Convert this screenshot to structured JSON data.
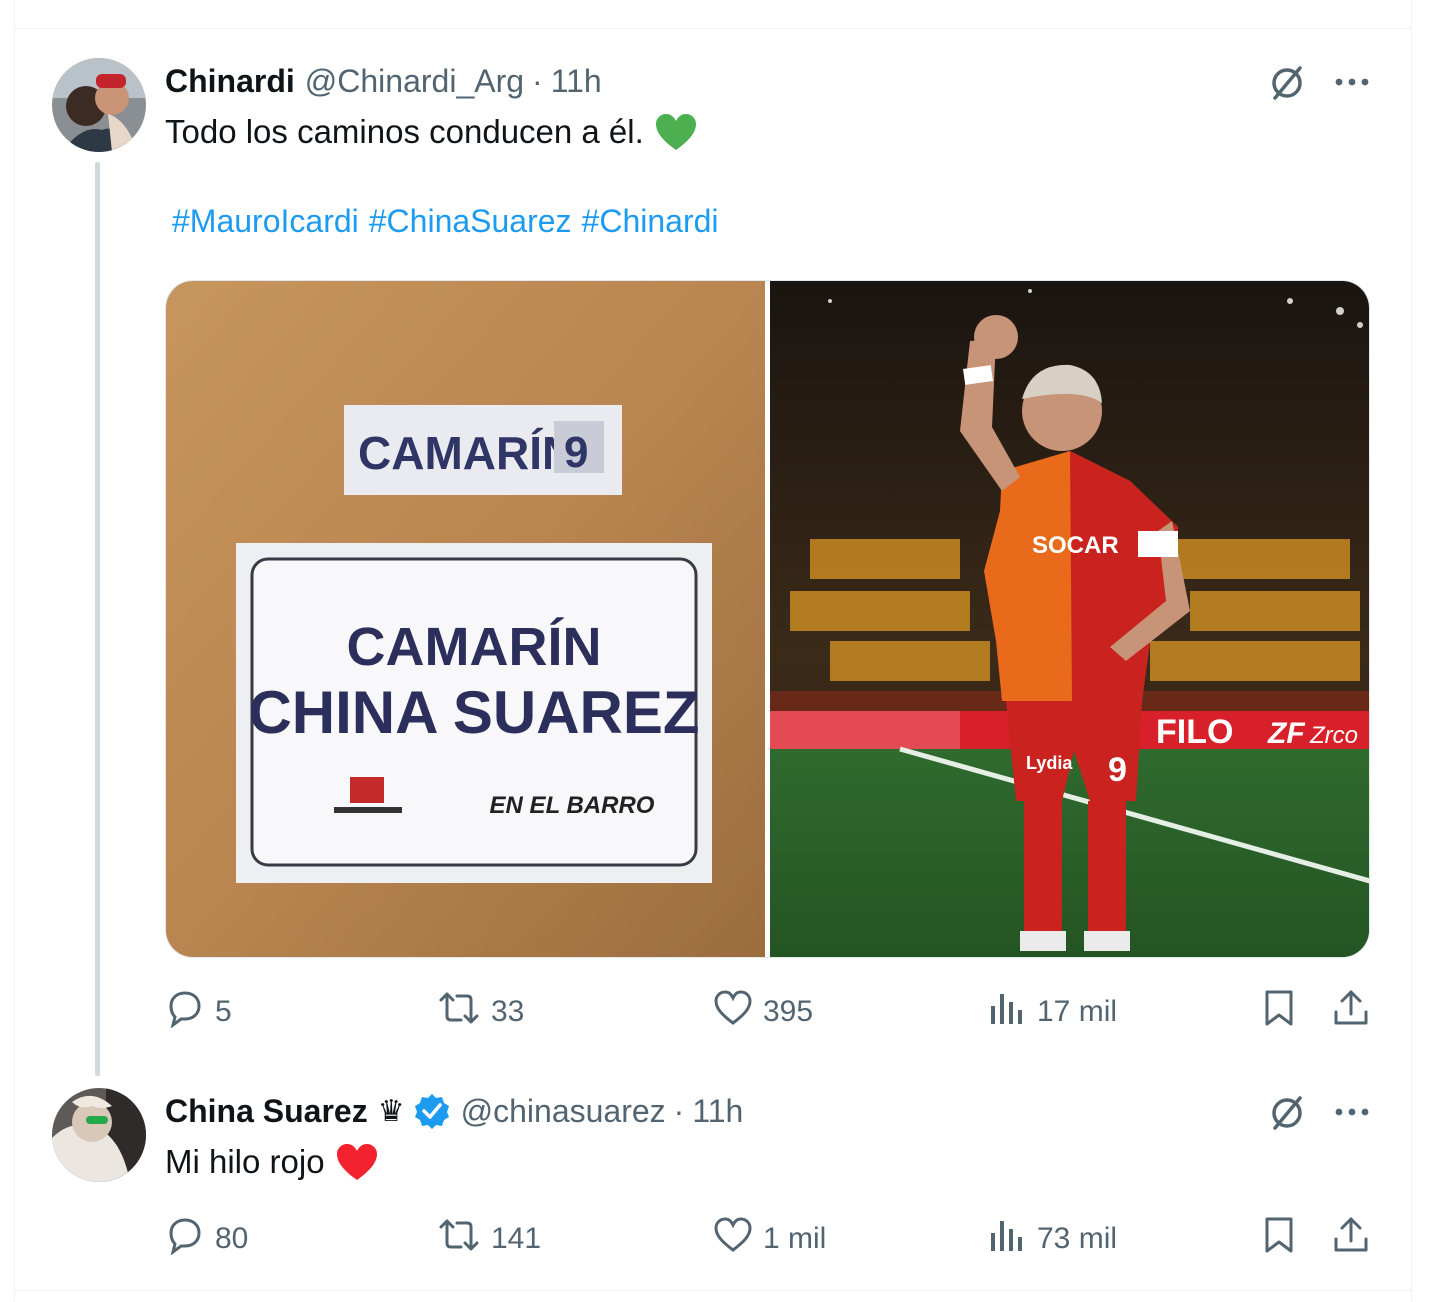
{
  "tweets": [
    {
      "name": "Chinardi",
      "handle": "@Chinardi_Arg",
      "separator": "·",
      "time": "11h",
      "text": "Todo los caminos conducen a él.",
      "emoji": "green-heart",
      "hashtags": [
        "#MauroIcardi",
        "#ChinaSuarez",
        "#Chinardi"
      ],
      "media": {
        "left_sign_small": "CAMARÍN",
        "left_sign_number": "9",
        "left_sign_line1": "CAMARÍN",
        "left_sign_line2": "CHINA SUAREZ",
        "left_sign_logo": "EN EL BARRO",
        "right_sponsor": "SOCAR",
        "right_board1": "FILO",
        "right_board2": "ZF",
        "right_board2b": "Zrco",
        "right_shorts": "Lydia",
        "right_number": "9"
      },
      "actions": {
        "replies": "5",
        "retweets": "33",
        "likes": "395",
        "views": "17 mil"
      }
    },
    {
      "name": "China Suarez",
      "crown": "♛",
      "verified": true,
      "handle": "@chinasuarez",
      "separator": "·",
      "time": "11h",
      "text": "Mi hilo rojo",
      "emoji": "red-heart",
      "actions": {
        "replies": "80",
        "retweets": "141",
        "likes": "1 mil",
        "views": "73 mil"
      }
    }
  ],
  "colors": {
    "accent": "#1d9bf0",
    "text": "#0f1419",
    "secondary": "#536471",
    "green_heart": "#4caf50",
    "red_heart": "#f4212e"
  }
}
